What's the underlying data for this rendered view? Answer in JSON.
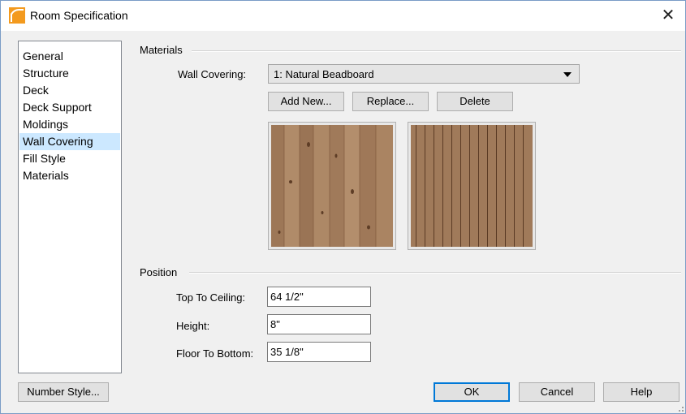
{
  "window": {
    "title": "Room Specification",
    "close_glyph": "✕"
  },
  "nav": {
    "items": [
      "General",
      "Structure",
      "Deck",
      "Deck Support",
      "Moldings",
      "Wall Covering",
      "Fill Style",
      "Materials"
    ],
    "selected": "Wall Covering"
  },
  "materials": {
    "group_label": "Materials",
    "wall_covering_label": "Wall Covering:",
    "wall_covering_value": "1: Natural Beadboard",
    "add_new_label": "Add New...",
    "replace_label": "Replace...",
    "delete_label": "Delete"
  },
  "position": {
    "group_label": "Position",
    "top_to_ceiling_label": "Top To Ceiling:",
    "top_to_ceiling_value": "64 1/2\"",
    "height_label": "Height:",
    "height_value": "8\"",
    "floor_to_bottom_label": "Floor To Bottom:",
    "floor_to_bottom_value": "35 1/8\""
  },
  "footer": {
    "number_style_label": "Number Style...",
    "ok_label": "OK",
    "cancel_label": "Cancel",
    "help_label": "Help"
  },
  "colors": {
    "selection": "#cce8ff",
    "wood_light": "#a07a5a",
    "wood_dark": "#8d6446",
    "default_button_border": "#0078d7"
  },
  "icons": {
    "app": "house-roof-icon",
    "close": "close-icon",
    "dropdown": "chevron-down-icon"
  }
}
